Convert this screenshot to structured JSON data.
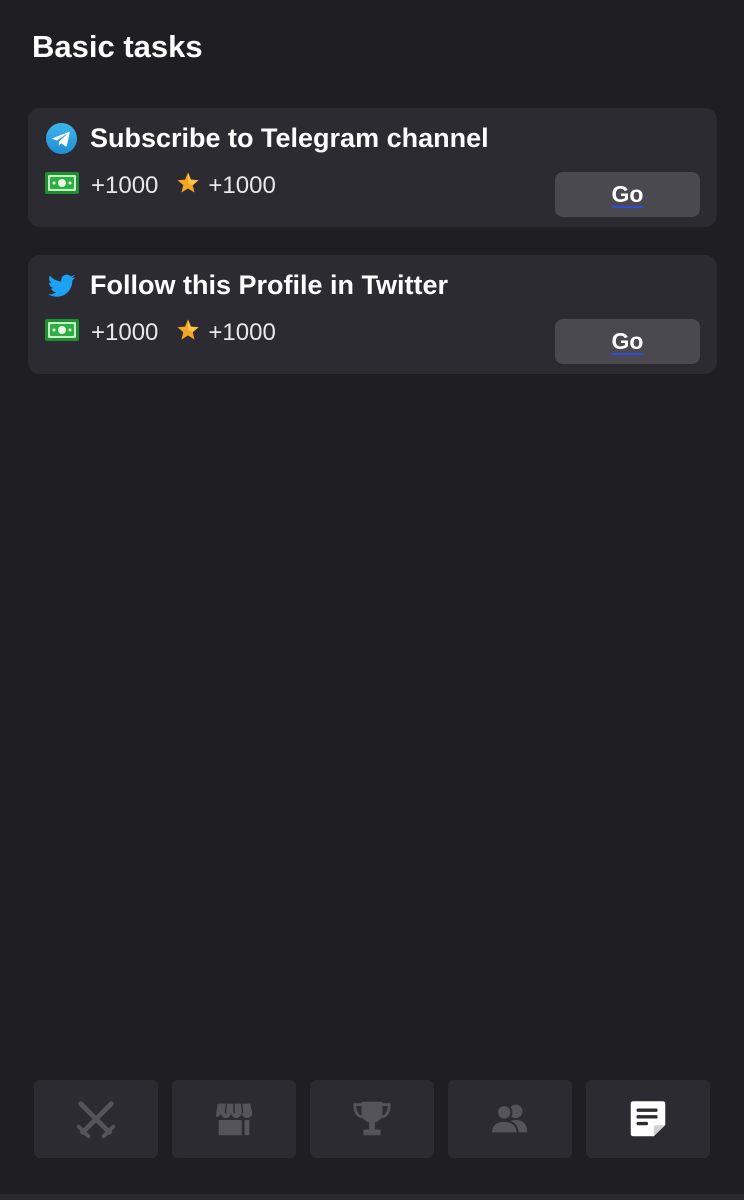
{
  "page": {
    "title": "Basic tasks"
  },
  "tasks": [
    {
      "icon": "telegram-icon",
      "title": "Subscribe to Telegram channel",
      "cash_reward": "+1000",
      "star_reward": "+1000",
      "button_label": "Go"
    },
    {
      "icon": "twitter-icon",
      "title": "Follow this Profile in Twitter",
      "cash_reward": "+1000",
      "star_reward": "+1000",
      "button_label": "Go"
    }
  ],
  "nav": {
    "tabs": [
      {
        "icon": "crossed-swords-icon",
        "active": false
      },
      {
        "icon": "shop-icon",
        "active": false
      },
      {
        "icon": "trophy-icon",
        "active": false
      },
      {
        "icon": "friends-icon",
        "active": false
      },
      {
        "icon": "tasks-note-icon",
        "active": true
      }
    ]
  },
  "colors": {
    "background": "#1f1e23",
    "card": "#2c2b31",
    "button": "#4a4950",
    "nav_inactive_icon": "#55545b",
    "nav_active_icon": "#ffffff",
    "star": "#f5a623",
    "cash": "#22a33a",
    "telegram": "#2aa3e0",
    "twitter": "#1da1f2"
  }
}
